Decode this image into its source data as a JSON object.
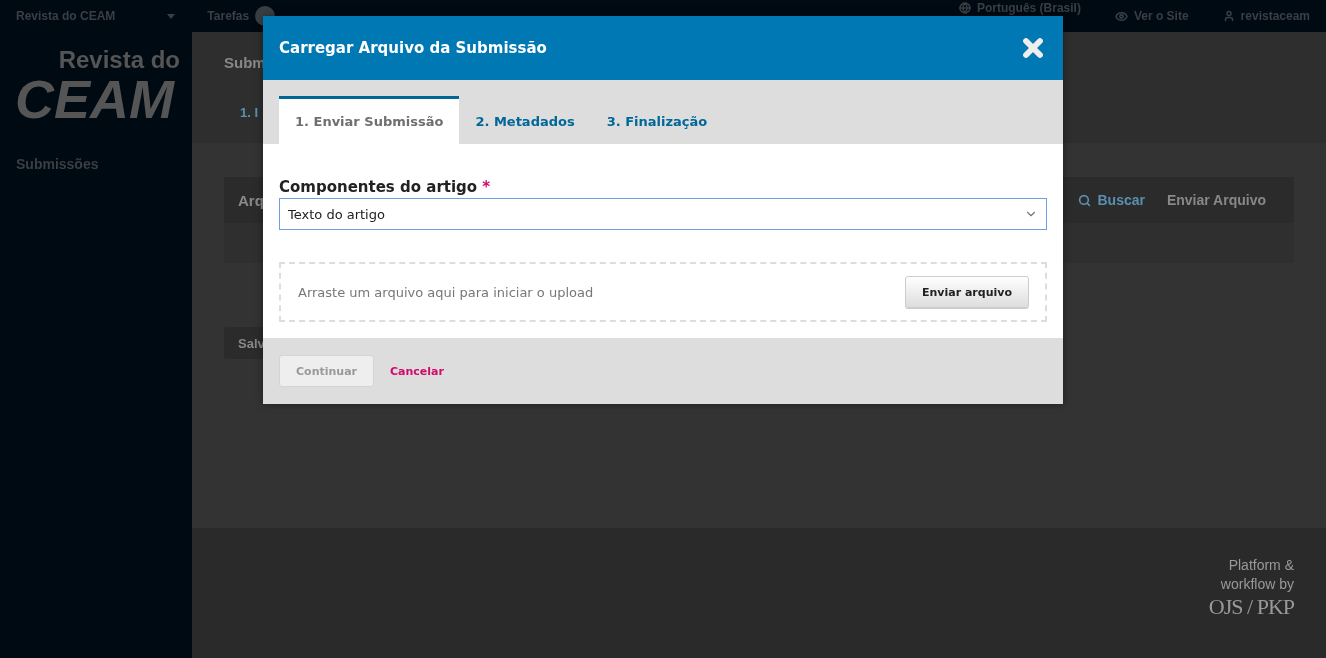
{
  "top_bar": {
    "site_menu": "Revista do CEAM",
    "tasks": {
      "label": "Tarefas"
    },
    "language": "Português (Brasil)",
    "view_site": "Ver o Site",
    "user": "revistaceam"
  },
  "sidebar": {
    "logo": {
      "line_1": "Revista do",
      "line_2": "CEAM"
    },
    "items": [
      {
        "label": "Submissões"
      }
    ]
  },
  "page": {
    "title": "Subm",
    "step_tab": "1. I",
    "panel_title": "Arq",
    "search": "Buscar",
    "upload_link": "Enviar Arquivo",
    "save_button": "Salv"
  },
  "modal": {
    "title": "Carregar Arquivo da Submissão",
    "tabs": [
      {
        "label": "1. Enviar Submissão",
        "selected": true
      },
      {
        "label": "2. Metadados",
        "selected": false
      },
      {
        "label": "3. Finalização",
        "selected": false
      }
    ],
    "field": {
      "label": "Componentes do artigo",
      "required_mark": "*",
      "value": "Texto do artigo"
    },
    "drop_zone": {
      "text": "Arraste um arquivo aqui para iniciar o upload",
      "button": "Enviar arquivo"
    },
    "buttons": [
      {
        "kind": "primary",
        "label": "Continuar",
        "disabled": true
      },
      {
        "kind": "cancel",
        "label": "Cancelar",
        "disabled": false
      }
    ]
  },
  "footer": {
    "line_1": "Platform &",
    "line_2": "workflow by",
    "brand": "OJS / PKP"
  }
}
